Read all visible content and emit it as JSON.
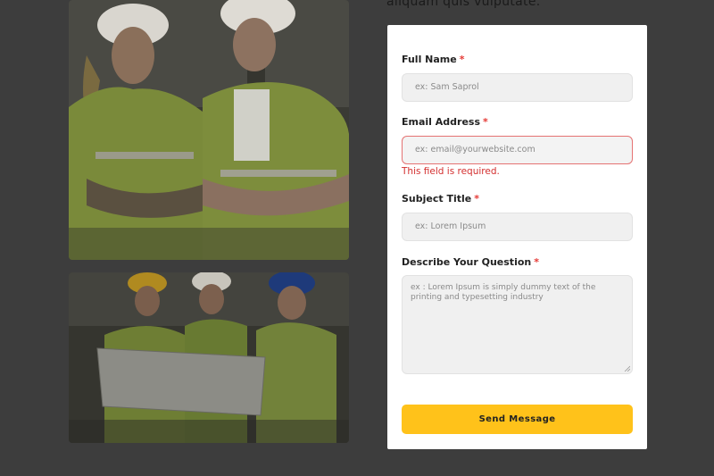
{
  "intro_text": "aliquam quis vulputate.",
  "form": {
    "full_name": {
      "label": "Full Name",
      "required_mark": "*",
      "placeholder": "ex: Sam Saprol"
    },
    "email": {
      "label": "Email Address",
      "required_mark": "*",
      "placeholder": "ex: email@yourwebsite.com",
      "error": "This field is required."
    },
    "subject": {
      "label": "Subject Title",
      "required_mark": "*",
      "placeholder": "ex: Lorem Ipsum"
    },
    "question": {
      "label": "Describe Your Question",
      "required_mark": "*",
      "placeholder": "ex : Lorem Ipsum is simply dummy text of the printing and typesetting industry"
    },
    "submit_label": "Send Message"
  },
  "colors": {
    "accent": "#ffc21a",
    "error": "#d32f2f",
    "required": "#e53935",
    "background": "#3d3d3d"
  }
}
